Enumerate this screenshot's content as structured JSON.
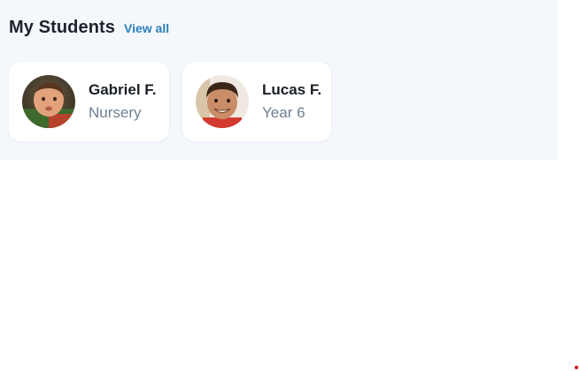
{
  "section": {
    "title": "My Students",
    "view_all_label": "View all"
  },
  "students": [
    {
      "name": "Gabriel F.",
      "grade": "Nursery",
      "avatar": "child-photo-avatar"
    },
    {
      "name": "Lucas F.",
      "grade": "Year 6",
      "avatar": "child-photo-avatar"
    }
  ],
  "colors": {
    "panel_background": "#f4f7fb",
    "link": "#2c7fb8",
    "name_text": "#1a1f26",
    "grade_text": "#6f7f92",
    "indicator_dot": "#d0101a"
  }
}
